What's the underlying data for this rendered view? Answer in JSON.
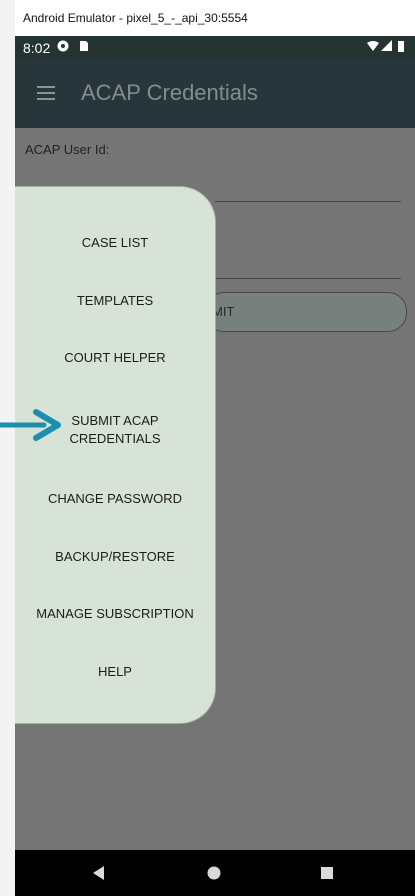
{
  "window": {
    "title": "Android Emulator - pixel_5_-_api_30:5554"
  },
  "status_bar": {
    "time": "8:02"
  },
  "app_bar": {
    "title": "ACAP Credentials",
    "menu_icon": "hamburger-menu-icon"
  },
  "form": {
    "user_id_label": "ACAP User Id:",
    "submit_partial": "MIT"
  },
  "drawer": {
    "items": [
      {
        "label": "CASE LIST"
      },
      {
        "label": "TEMPLATES"
      },
      {
        "label": "COURT HELPER"
      },
      {
        "label": "SUBMIT ACAP\nCREDENTIALS"
      },
      {
        "label": "CHANGE PASSWORD"
      },
      {
        "label": "BACKUP/RESTORE"
      },
      {
        "label": "MANAGE SUBSCRIPTION"
      },
      {
        "label": "HELP"
      }
    ]
  },
  "annotation": {
    "arrow_color": "#1a8fb1",
    "icon": "pointer-arrow-icon"
  },
  "nav_bar": {
    "icons": [
      "back-icon",
      "home-icon",
      "recents-icon"
    ]
  },
  "colors": {
    "drawer_bg": "#d7e3d6",
    "app_bar": "#27363a",
    "scrim": "#757575"
  }
}
